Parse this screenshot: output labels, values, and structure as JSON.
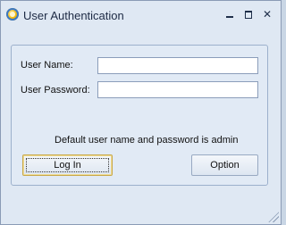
{
  "window": {
    "title": "User Authentication",
    "minimize": "",
    "maximize": "",
    "close": "✕"
  },
  "form": {
    "username_label": "User Name:",
    "password_label": "User Password:",
    "username_value": "",
    "password_value": "",
    "note": "Default user name and password is admin"
  },
  "buttons": {
    "login": "Log In",
    "option": "Option"
  }
}
